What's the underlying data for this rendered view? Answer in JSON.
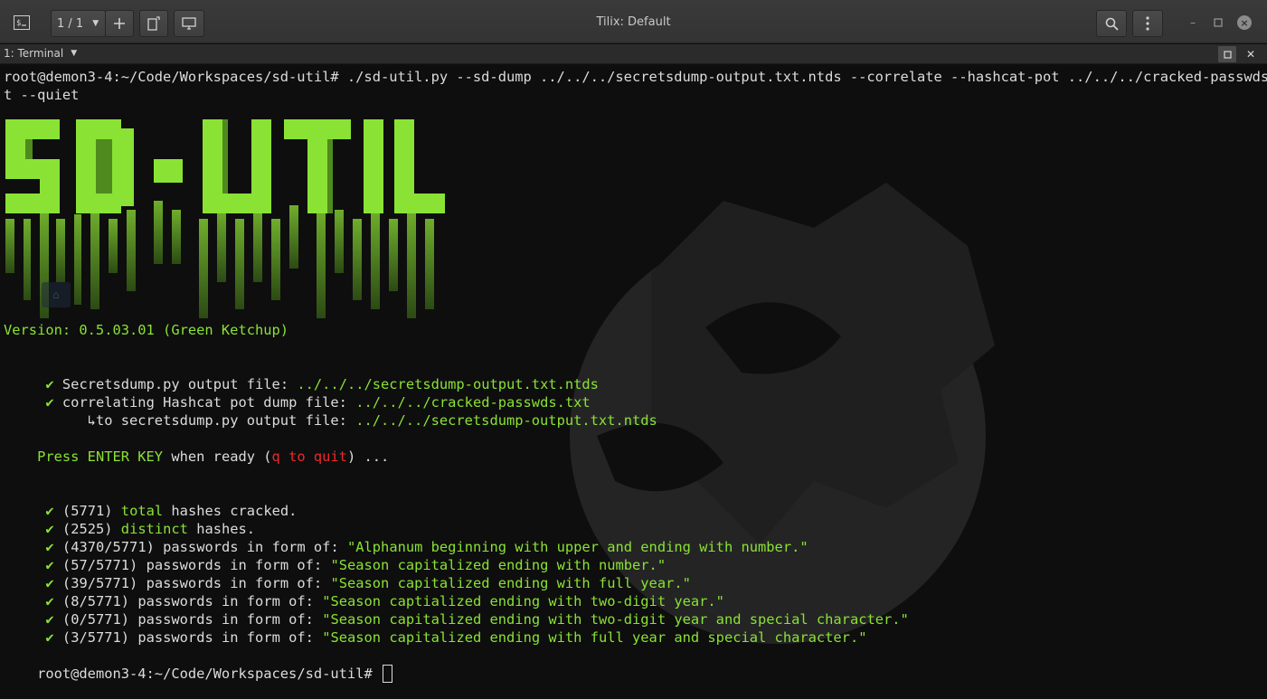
{
  "window": {
    "title": "Tilix: Default",
    "session_selector": "1 / 1",
    "terminal_tab": "1: Terminal"
  },
  "icons": {
    "app": "terminal-app-icon",
    "add_terminal": "plus-icon",
    "add_right": "split-right-icon",
    "add_down": "split-down-icon",
    "search": "search-icon",
    "menu": "vertical-dots-icon",
    "minimize": "minimize-icon",
    "maximize": "maximize-icon",
    "close": "close-icon"
  },
  "colors": {
    "accent_green": "#8ae234",
    "quit_red": "#ef2929",
    "background": "#0e0e0e",
    "text": "#dcdcdc"
  },
  "terminal": {
    "command_line_1": "root@demon3-4:~/Code/Workspaces/sd-util# ./sd-util.py --sd-dump ../../../secretsdump-output.txt.ntds --correlate --hashcat-pot ../../../cracked-passwds.tx",
    "command_line_2": "t --quiet",
    "banner_text": "SD-UTIL",
    "version": "Version: 0.5.03.01 (Green Ketchup)",
    "check_mark": "✔",
    "secretsdump_label": " Secretsdump.py output file: ",
    "secretsdump_path": "../../../secretsdump-output.txt.ntds",
    "hashcat_label": " correlating Hashcat pot dump file: ",
    "hashcat_path": "../../../cracked-passwds.txt",
    "to_label": "      ↳to secretsdump.py output file: ",
    "to_path": "../../../secretsdump-output.txt.ntds",
    "press_enter": "Press ENTER KEY",
    "when_ready": " when ready (",
    "quit_hint": "q to quit",
    "ready_end": ") ...",
    "results": [
      {
        "count": "(5771) ",
        "keyword": "total",
        "rest": " hashes cracked."
      },
      {
        "count": "(2525) ",
        "keyword": "distinct",
        "rest": " hashes."
      }
    ],
    "forms": [
      {
        "count": "(4370/5771)",
        "text": " passwords in form of: ",
        "desc": "\"Alphanum beginning with upper and ending with number.\""
      },
      {
        "count": "(57/5771)",
        "text": " passwords in form of: ",
        "desc": "\"Season capitalized ending with number.\""
      },
      {
        "count": "(39/5771)",
        "text": " passwords in form of: ",
        "desc": "\"Season capitalized ending with full year.\""
      },
      {
        "count": "(8/5771)",
        "text": " passwords in form of: ",
        "desc": "\"Season captialized ending with two-digit year.\""
      },
      {
        "count": "(0/5771)",
        "text": " passwords in form of: ",
        "desc": "\"Season capitalized ending with two-digit year and special character.\""
      },
      {
        "count": "(3/5771)",
        "text": " passwords in form of: ",
        "desc": "\"Season capitalized ending with full year and special character.\""
      }
    ],
    "final_prompt": "root@demon3-4:~/Code/Workspaces/sd-util# "
  }
}
